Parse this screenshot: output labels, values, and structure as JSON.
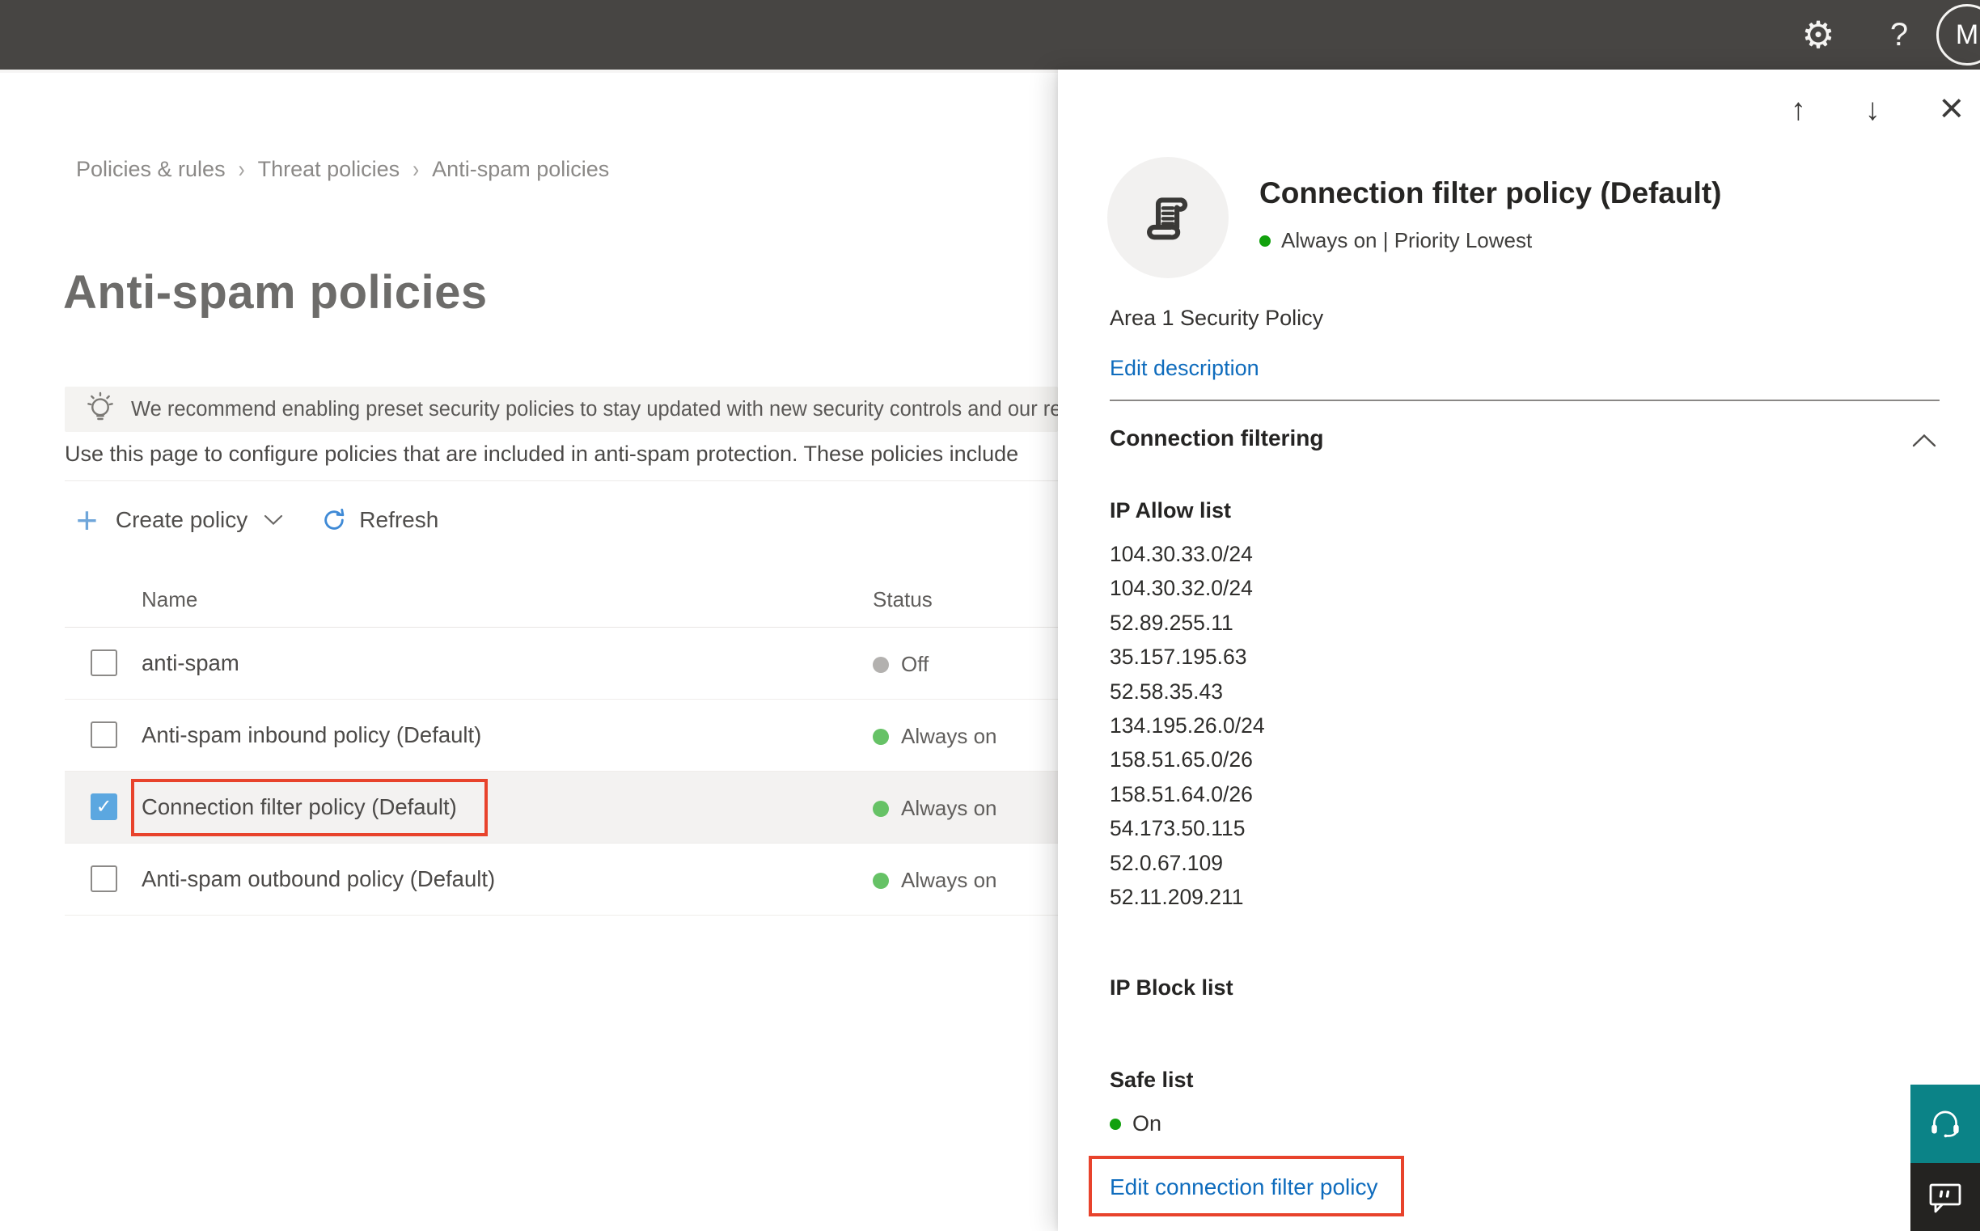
{
  "topbar": {
    "settings_icon": "⚙",
    "help_icon": "?",
    "avatar_initial": "M"
  },
  "breadcrumb": {
    "separator": "›",
    "items": [
      "Policies & rules",
      "Threat policies",
      "Anti-spam policies"
    ]
  },
  "page": {
    "title": "Anti-spam policies",
    "banner_text": "We recommend enabling preset security policies to stay updated with new security controls and our recomme",
    "description": "Use this page to configure policies that are included in anti-spam protection. These policies include"
  },
  "toolbar": {
    "create_policy_label": "Create policy",
    "refresh_label": "Refresh"
  },
  "table": {
    "columns": {
      "name": "Name",
      "status": "Status"
    },
    "rows": [
      {
        "name": "anti-spam",
        "status": "Off",
        "status_color": "#b3b1af",
        "checked": false,
        "selected": false
      },
      {
        "name": "Anti-spam inbound policy (Default)",
        "status": "Always on",
        "status_color": "#66c266",
        "checked": false,
        "selected": false
      },
      {
        "name": "Connection filter policy (Default)",
        "status": "Always on",
        "status_color": "#66c266",
        "checked": true,
        "selected": true,
        "annotated": true
      },
      {
        "name": "Anti-spam outbound policy (Default)",
        "status": "Always on",
        "status_color": "#66c266",
        "checked": false,
        "selected": false
      }
    ]
  },
  "panel": {
    "up_icon": "↑",
    "down_icon": "↓",
    "close_icon": "×",
    "title": "Connection filter policy (Default)",
    "status_line": "Always on | Priority Lowest",
    "status_dot_color": "#12a10d",
    "description": "Area 1 Security Policy",
    "edit_description_label": "Edit description",
    "section_title": "Connection filtering",
    "ip_allow_title": "IP Allow list",
    "ip_allow_list": [
      "104.30.33.0/24",
      "104.30.32.0/24",
      "52.89.255.11",
      "35.157.195.63",
      "52.58.35.43",
      "134.195.26.0/24",
      "158.51.65.0/26",
      "158.51.64.0/26",
      "54.173.50.115",
      "52.0.67.109",
      "52.11.209.211"
    ],
    "ip_block_title": "IP Block list",
    "safe_list_title": "Safe list",
    "safe_list_status": "On",
    "edit_link_label": "Edit connection filter policy"
  },
  "annotations": {
    "highlight_color": "#e8432c",
    "highlighted": [
      "table-row-connection-filter-name",
      "edit-connection-filter-policy-link"
    ]
  },
  "colors": {
    "topbar_bg": "#474543",
    "accent_blue": "#0f6cbd",
    "checkbox_checked": "#5ba7e0",
    "status_green_table": "#66c266",
    "status_green_panel": "#12a10d",
    "status_gray": "#b3b1af",
    "selected_row_bg": "#f3f2f1",
    "banner_bg": "#f4f3f1",
    "support_teal": "#0b8387",
    "feedback_dark": "#242321",
    "annotation_red": "#e8432c"
  }
}
